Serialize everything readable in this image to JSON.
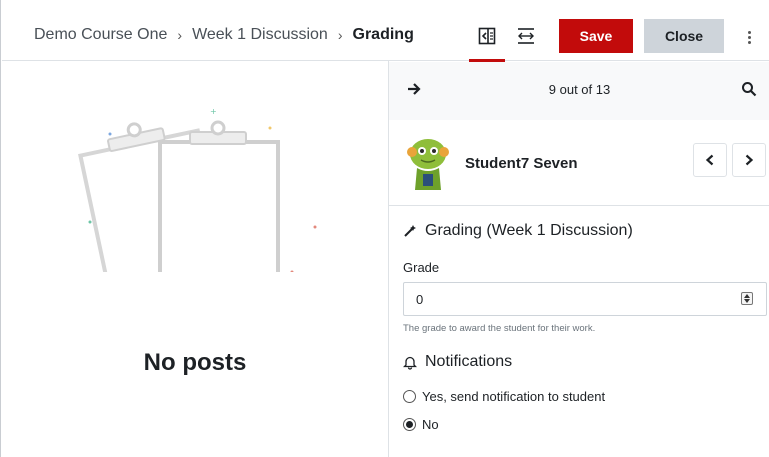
{
  "header": {
    "breadcrumbs": [
      "Demo Course One",
      "Week 1 Discussion",
      "Grading"
    ],
    "save_label": "Save",
    "close_label": "Close"
  },
  "left": {
    "empty_title": "No posts"
  },
  "grader": {
    "counter": "9 out of 13",
    "student_name": "Student7 Seven",
    "grading_title": "Grading (Week 1 Discussion)",
    "grade_label": "Grade",
    "grade_value": "0",
    "grade_help": "The grade to award the student for their work.",
    "notifications_title": "Notifications",
    "notify_options": [
      {
        "label": "Yes, send notification to student",
        "checked": false
      },
      {
        "label": "No",
        "checked": true
      }
    ]
  },
  "colors": {
    "accent": "#c20b0b",
    "close_bg": "#ced4da",
    "nav_bg": "#f8f9fa"
  },
  "icons": [
    "collapse-panel-icon",
    "expand-width-icon",
    "kebab-menu-icon",
    "arrow-right-icon",
    "search-icon",
    "chevron-left-icon",
    "chevron-right-icon",
    "wand-icon",
    "bell-icon"
  ]
}
